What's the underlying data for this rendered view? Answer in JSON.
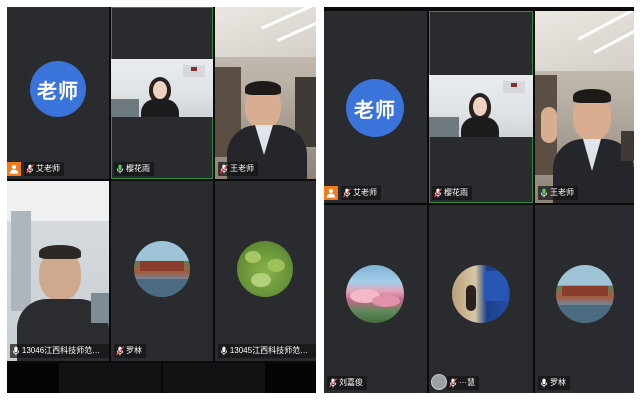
{
  "left_panel": {
    "tiles": [
      {
        "name": "艾老师",
        "avatar_text": "老师",
        "host": true
      },
      {
        "name": "樱花雨"
      },
      {
        "name": "王老师"
      },
      {
        "name": "13046江西科技师范大..."
      },
      {
        "name": "罗林"
      },
      {
        "name": "13045江西科技师范大..."
      }
    ]
  },
  "right_panel": {
    "tiles": [
      {
        "name": "艾老师",
        "avatar_text": "老师",
        "host": true
      },
      {
        "name": "樱花雨"
      },
      {
        "name": "王老师"
      },
      {
        "name": "刘嘉俊"
      },
      {
        "name": "···慧"
      },
      {
        "name": "罗林"
      }
    ]
  },
  "icons": {
    "mic": "mic-icon",
    "mic_muted": "mic-muted-icon",
    "host": "host-person-icon"
  },
  "colors": {
    "avatar_blue": "#3a73d9",
    "host_orange": "#f07a1c",
    "speaking_green": "#2e8b3e",
    "tile_bg": "#2a2b2f"
  }
}
